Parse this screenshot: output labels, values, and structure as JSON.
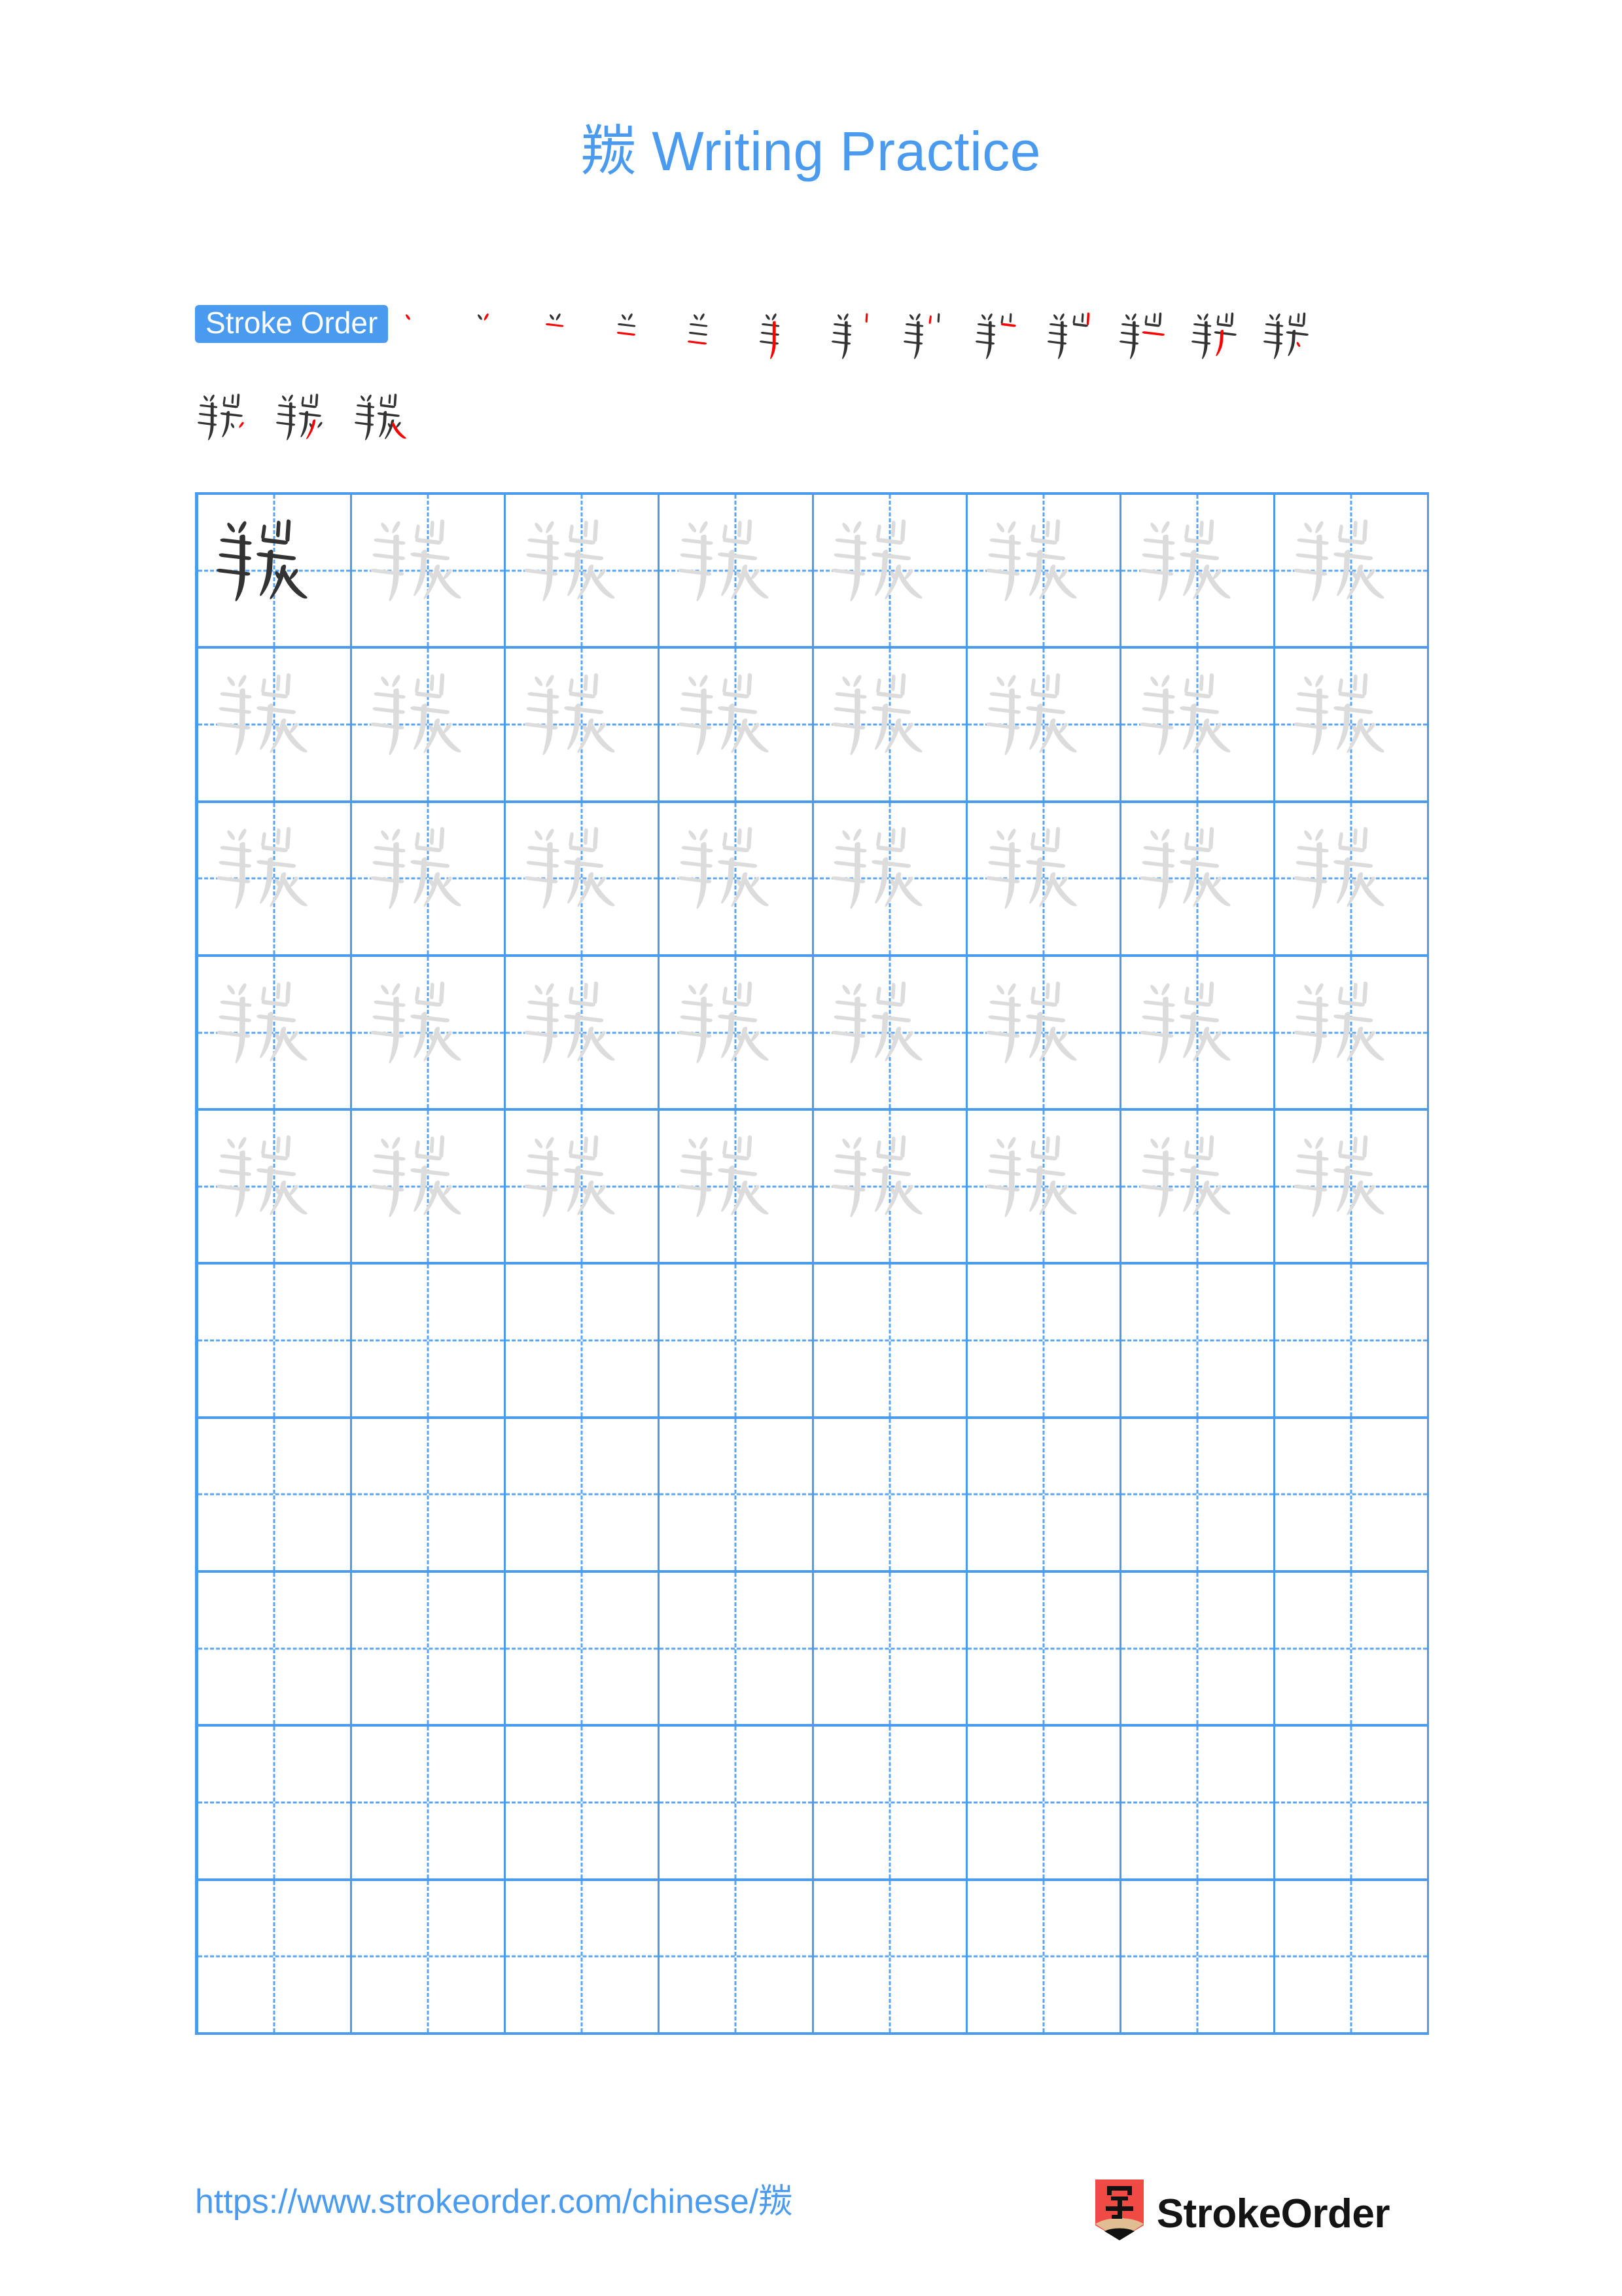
{
  "character": "羰",
  "header": {
    "title": "羰 Writing Practice"
  },
  "stroke_order": {
    "badge_label": "Stroke Order",
    "total_strokes": 16,
    "steps_row1_count": 13,
    "steps_row2_count": 3,
    "new_stroke_color": "#ff0000",
    "existing_stroke_color": "#333333"
  },
  "grid": {
    "columns": 8,
    "rows": 10,
    "filled_rows": 5,
    "empty_rows": 5,
    "model_char_color": "#333333",
    "trace_char_color": "#dcdcdc",
    "line_color": "#4a9bf0",
    "guide_color": "#5ba4f2"
  },
  "footer": {
    "url": "https://www.strokeorder.com/chinese/羰",
    "brand_name": "StrokeOrder",
    "logo_char": "字",
    "logo_color": "#ef4a44"
  },
  "colors": {
    "accent": "#4a9bf0",
    "background": "#ffffff",
    "ink": "#333333",
    "highlight": "#ff0000"
  }
}
